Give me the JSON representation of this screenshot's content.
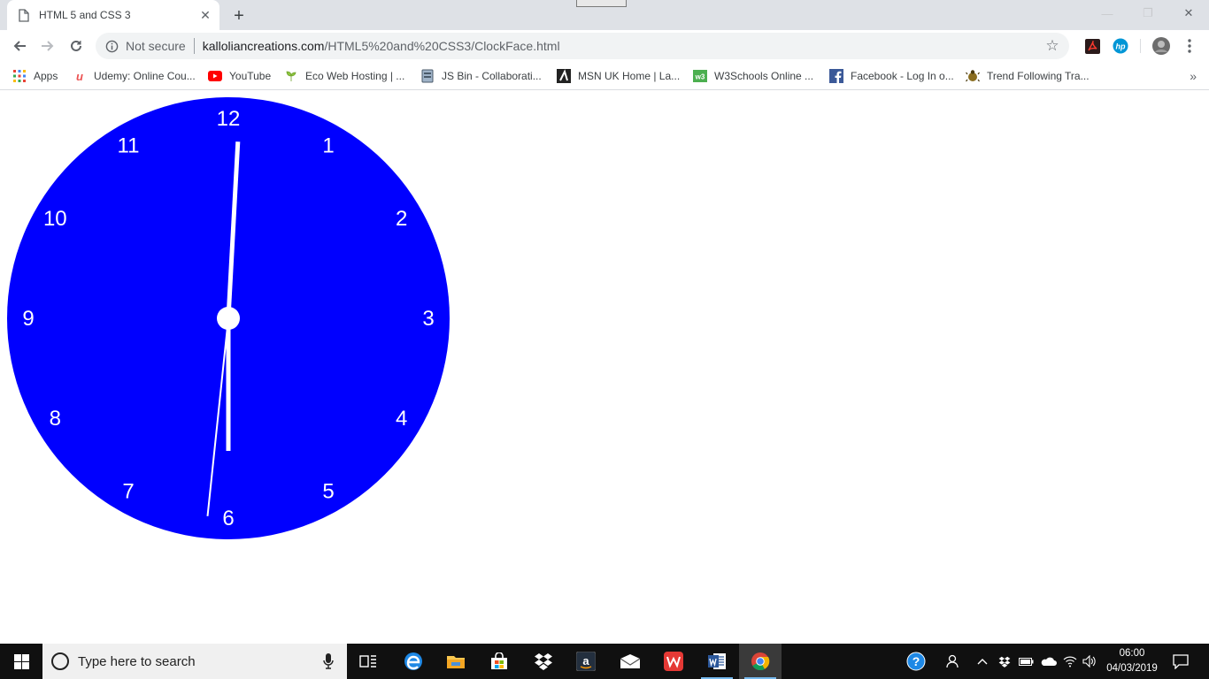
{
  "browser": {
    "tab": {
      "title": "HTML 5 and CSS 3",
      "close": "✕",
      "new_tab": "+"
    },
    "window_controls": {
      "minimize": "—",
      "restore": "❐",
      "close": "✕"
    },
    "address": {
      "security_label": "Not secure",
      "url_host": "kalloliancreations.com",
      "url_path": "/HTML5%20and%20CSS3/ClockFace.html"
    },
    "bookmarks": [
      {
        "label": "Apps",
        "icon": "apps-grid-icon",
        "color": "#4285f4"
      },
      {
        "label": "Udemy: Online Cou...",
        "icon": "udemy-icon",
        "color": "#ec5252"
      },
      {
        "label": "YouTube",
        "icon": "youtube-icon",
        "color": "#ff0000"
      },
      {
        "label": "Eco Web Hosting | ...",
        "icon": "eco-hosting-icon",
        "color": "#8dc63f"
      },
      {
        "label": "JS Bin - Collaborati...",
        "icon": "jsbin-icon",
        "color": "#6b7c93"
      },
      {
        "label": "MSN UK Home | La...",
        "icon": "msn-icon",
        "color": "#222222"
      },
      {
        "label": "W3Schools Online ...",
        "icon": "w3schools-icon",
        "color": "#4caf50"
      },
      {
        "label": "Facebook - Log In o...",
        "icon": "facebook-icon",
        "color": "#3b5998"
      },
      {
        "label": "Trend Following Tra...",
        "icon": "trend-following-icon",
        "color": "#8a6d1f"
      }
    ],
    "more_bookmarks": "»"
  },
  "clock_face": {
    "face_color": "#0000ff",
    "hand_color": "#ffffff",
    "numerals": [
      "12",
      "1",
      "2",
      "3",
      "4",
      "5",
      "6",
      "7",
      "8",
      "9",
      "10",
      "11"
    ],
    "time": {
      "hours": 6,
      "minutes": 0,
      "seconds": 31
    }
  },
  "taskbar": {
    "search_placeholder": "Type here to search",
    "apps": [
      "task-view",
      "edge",
      "file-explorer",
      "store",
      "dropbox",
      "amazon",
      "mail",
      "wps-office",
      "word",
      "chrome"
    ],
    "clock_time": "06:00",
    "clock_date": "04/03/2019"
  }
}
